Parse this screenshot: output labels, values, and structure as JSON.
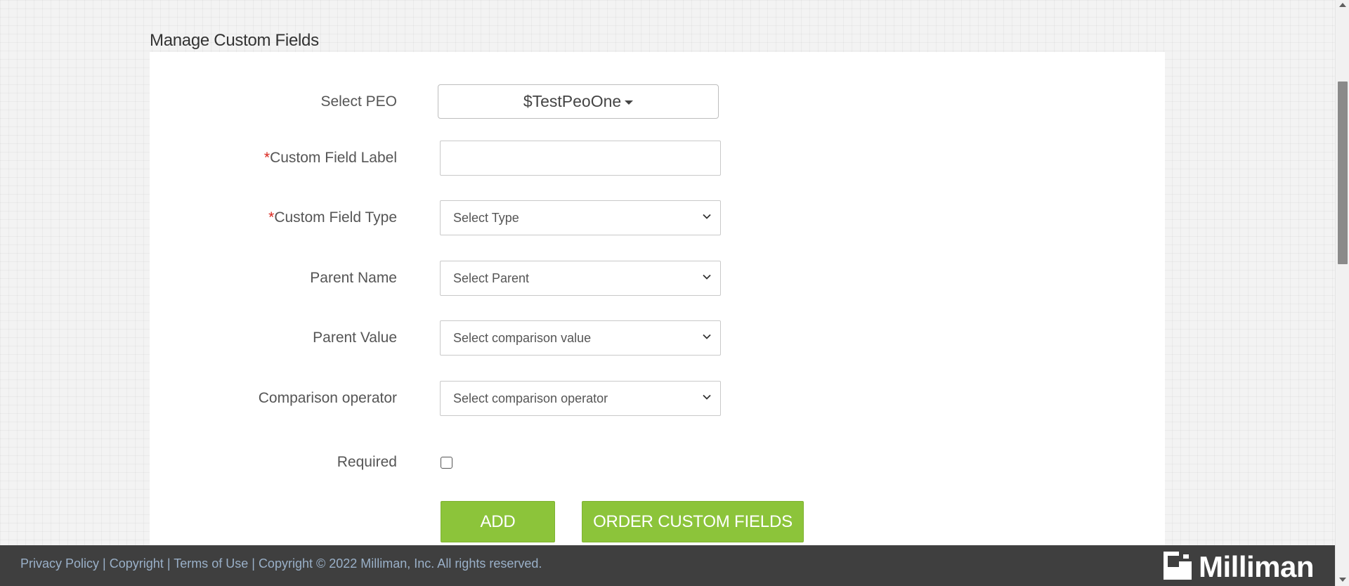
{
  "page": {
    "title": "Manage Custom Fields"
  },
  "form": {
    "select_peo": {
      "label": "Select PEO",
      "value": "$TestPeoOne"
    },
    "custom_field_label": {
      "required_mark": "*",
      "label": "Custom Field Label",
      "value": ""
    },
    "custom_field_type": {
      "required_mark": "*",
      "label": "Custom Field Type",
      "selected": "Select Type"
    },
    "parent_name": {
      "label": "Parent Name",
      "selected": "Select Parent"
    },
    "parent_value": {
      "label": "Parent Value",
      "selected": "Select comparison value"
    },
    "comparison_operator": {
      "label": "Comparison operator",
      "selected": "Select comparison operator"
    },
    "required": {
      "label": "Required",
      "checked": false
    }
  },
  "actions": {
    "add_label": "ADD",
    "order_label": "ORDER CUSTOM FIELDS"
  },
  "footer": {
    "privacy": "Privacy Policy",
    "sep": "|",
    "copyright_link": "Copyright",
    "terms": "Terms of Use",
    "copyright_text": "Copyright © 2022 Milliman, Inc. All rights reserved.",
    "logo_text": "Milliman"
  },
  "colors": {
    "accent": "#8cc43a",
    "footer_bg": "#3f3f3f",
    "required": "#d9241c"
  }
}
